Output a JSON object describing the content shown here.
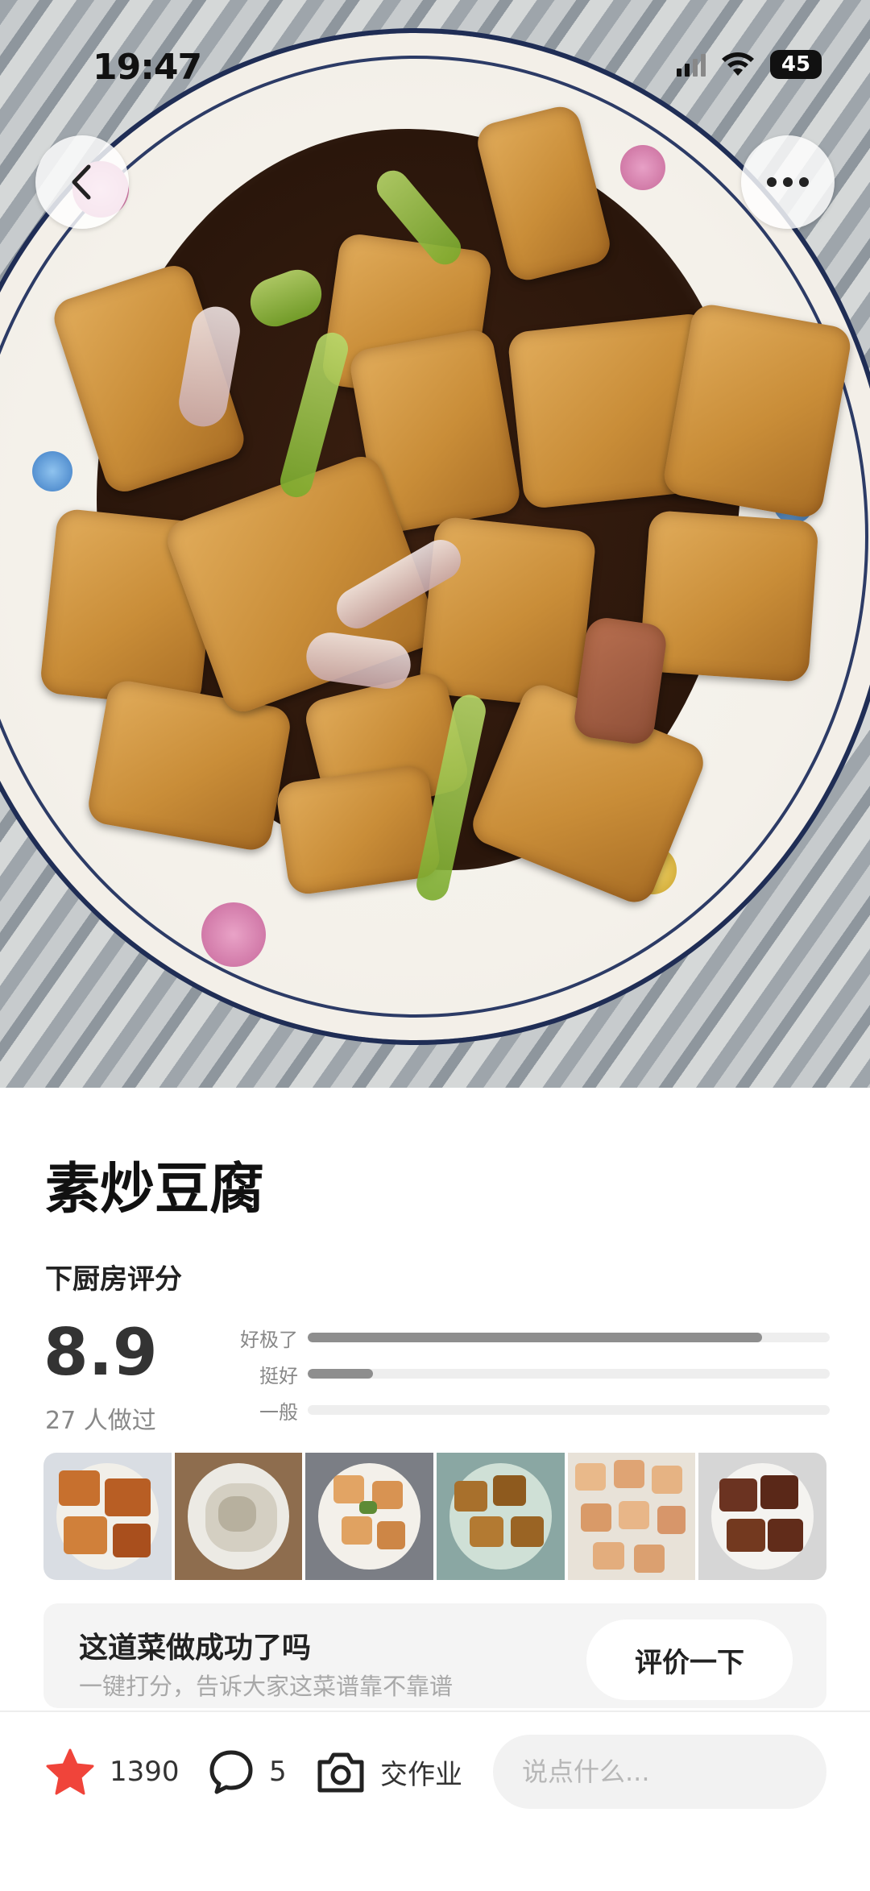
{
  "status_bar": {
    "time": "19:47",
    "battery": "45"
  },
  "hero": {
    "back_icon": "chevron-left-icon",
    "more_icon": "ellipsis-icon"
  },
  "recipe": {
    "title": "素炒豆腐",
    "rating_label": "下厨房评分",
    "score": "8.9",
    "cooked_count": "27 人做过",
    "rating_bars": [
      {
        "label": "好极了",
        "fraction": 0.87
      },
      {
        "label": "挺好",
        "fraction": 0.125
      },
      {
        "label": "一般",
        "fraction": 0.0
      }
    ]
  },
  "thumbnails": [
    "thumbnail-1",
    "thumbnail-2",
    "thumbnail-3",
    "thumbnail-4",
    "thumbnail-5",
    "thumbnail-6"
  ],
  "prompt_card": {
    "title": "这道菜做成功了吗",
    "subtitle": "一键打分，告诉大家这菜谱靠不靠谱",
    "button": "评价一下"
  },
  "bottom_bar": {
    "favorites": "1390",
    "comments": "5",
    "homework": "交作业",
    "comment_placeholder": "说点什么..."
  },
  "colors": {
    "star": "#f0443a",
    "bar_fill": "#8e8e8e",
    "bar_track": "#eeeeee"
  }
}
